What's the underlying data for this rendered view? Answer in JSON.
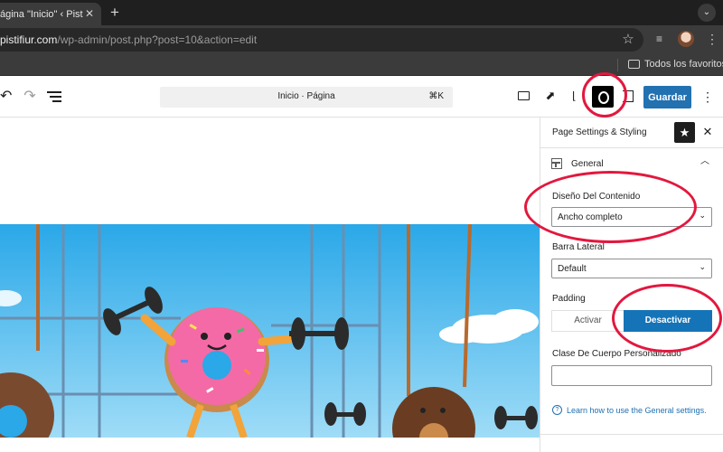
{
  "browser": {
    "tab_title": "ágina \"Inicio\" ‹ Pistifi",
    "tab_close": "✕",
    "new_tab": "+",
    "url_host": "pistifiur.com",
    "url_path": "/wp-admin/post.php?post=10&action=edit",
    "bookmark_label": "Todos los favoritos"
  },
  "toolbar": {
    "doc_title": "Inicio · Página",
    "doc_shortcut": "⌘K",
    "save_label": "Guardar"
  },
  "sidebar": {
    "title": "Page Settings & Styling",
    "panel_title": "General",
    "layout_label": "Diseño Del Contenido",
    "layout_value": "Ancho completo",
    "sidebar_label": "Barra Lateral",
    "sidebar_value": "Default",
    "padding_label": "Padding",
    "padding_off": "Activar",
    "padding_on": "Desactivar",
    "body_class_label": "Clase De Cuerpo Personalizado",
    "help_link": "Learn how to use the General settings."
  },
  "colors": {
    "accent": "#2271b1",
    "annotation": "#e2183e",
    "toggle_active": "#1574b8"
  }
}
